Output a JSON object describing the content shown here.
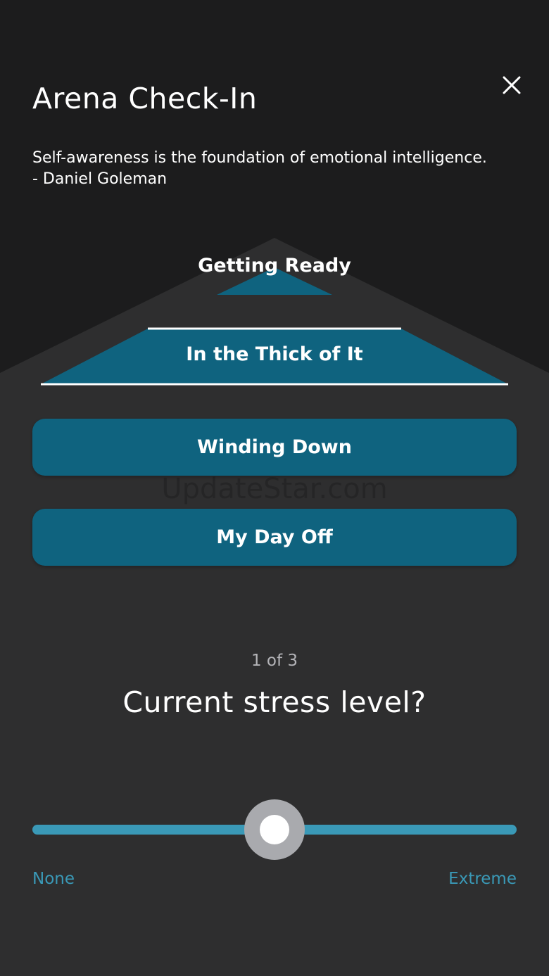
{
  "header": {
    "title": "Arena Check-In",
    "close_icon": "close-icon"
  },
  "quote": {
    "line1": "Self-awareness is the foundation of emotional intelligence.",
    "line2": "- Daniel Goleman"
  },
  "options": {
    "partial_label": "Getting Ready",
    "selected_label": "In the Thick of It",
    "items": [
      "Winding Down",
      "My Day Off"
    ]
  },
  "watermark": "UpdateStar.com",
  "question": {
    "step": "1 of 3",
    "text": "Current stress level?"
  },
  "slider": {
    "min_label": "None",
    "max_label": "Extreme",
    "value_fraction": 0.5
  },
  "colors": {
    "background": "#1c1c1d",
    "panel": "#2e2e2f",
    "option": "#0f637f",
    "accent": "#3a99b7",
    "thumb": "#a9aaae"
  }
}
